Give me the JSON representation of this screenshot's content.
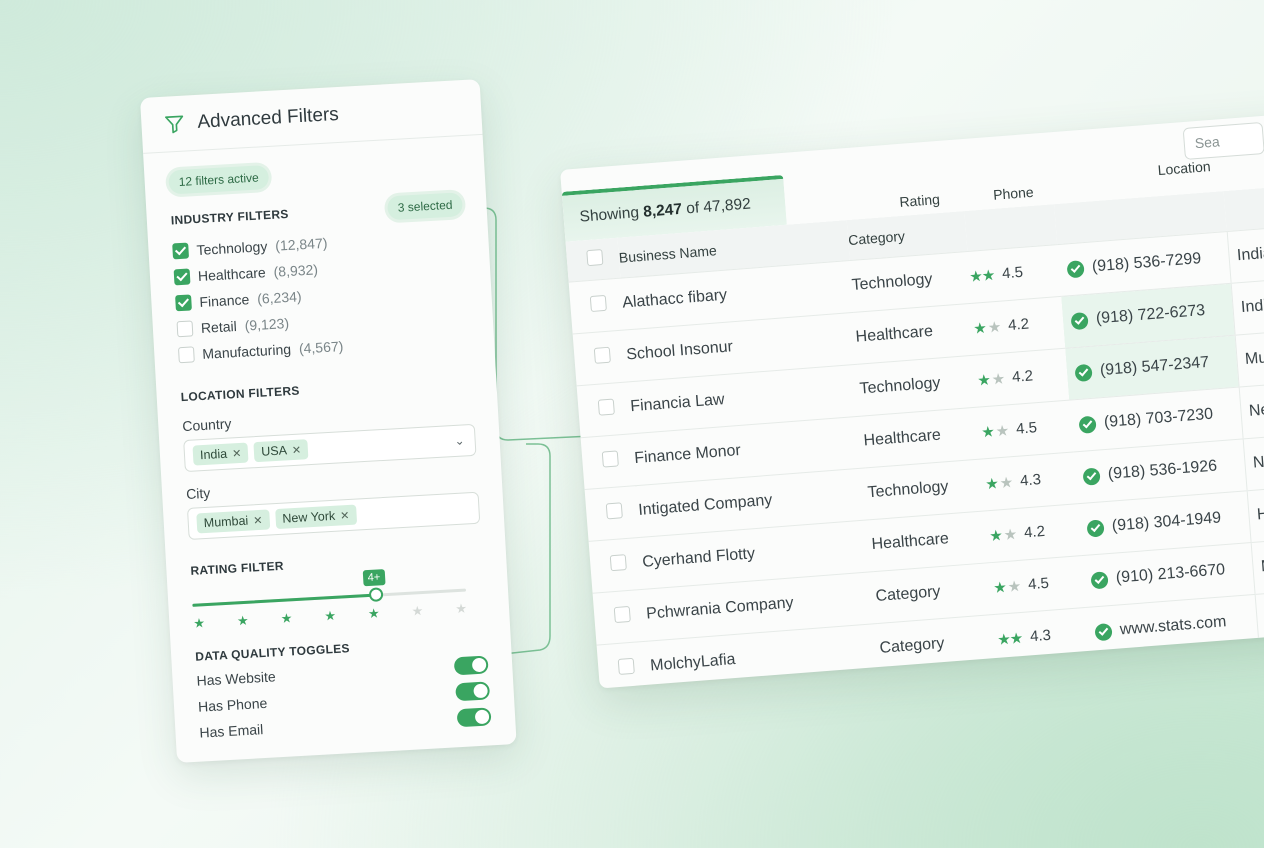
{
  "filters": {
    "title": "Advanced Filters",
    "active_badge": "12 filters active",
    "industry": {
      "title": "INDUSTRY FILTERS",
      "selected_badge": "3 selected",
      "items": [
        {
          "label": "Technology",
          "count": "(12,847)",
          "checked": true
        },
        {
          "label": "Healthcare",
          "count": "(8,932)",
          "checked": true
        },
        {
          "label": "Finance",
          "count": "(6,234)",
          "checked": true
        },
        {
          "label": "Retail",
          "count": "(9,123)",
          "checked": false
        },
        {
          "label": "Manufacturing",
          "count": "(4,567)",
          "checked": false
        }
      ]
    },
    "location": {
      "title": "LOCATION FILTERS",
      "country": {
        "label": "Country",
        "tags": [
          "India",
          "USA"
        ]
      },
      "city": {
        "label": "City",
        "tags": [
          "Mumbai",
          "New York"
        ]
      }
    },
    "rating": {
      "title": "RATING FILTER",
      "value_label": "4+",
      "min_stars": 4,
      "max_stars": 6,
      "fraction": 0.67
    },
    "toggles": {
      "title": "DATA QUALITY TOGGLES",
      "items": [
        {
          "label": "Has Website",
          "on": true
        },
        {
          "label": "Has Phone",
          "on": true
        },
        {
          "label": "Has Email",
          "on": true
        }
      ]
    }
  },
  "results": {
    "showing_prefix": "Showing",
    "showing_count": "8,247",
    "showing_of": "of 47,892",
    "search_placeholder": "Sea",
    "columns": {
      "name": "Business Name",
      "category": "Category",
      "rating": "Rating",
      "phone": "Phone",
      "location": "Location"
    },
    "rows": [
      {
        "name": "Alathacc fibary",
        "category": "Technology",
        "stars": "★★",
        "half": false,
        "rating": "4.5",
        "phone": "(918) 536-7299",
        "location": "India, Mumbai",
        "highlight": false
      },
      {
        "name": "School Insonur",
        "category": "Healthcare",
        "stars": "★",
        "half": true,
        "rating": "4.2",
        "phone": "(918) 722-6273",
        "location": "India, Mumbai",
        "highlight": true
      },
      {
        "name": "Financia Law",
        "category": "Technology",
        "stars": "★",
        "half": true,
        "rating": "4.2",
        "phone": "(918) 547-2347",
        "location": "Mumbai, India",
        "highlight": true
      },
      {
        "name": "Finance Monor",
        "category": "Healthcare",
        "stars": "★",
        "half": true,
        "rating": "4.5",
        "phone": "(918) 703-7230",
        "location": "New York",
        "highlight": false
      },
      {
        "name": "Intigated Company",
        "category": "Technology",
        "stars": "★",
        "half": true,
        "rating": "4.3",
        "phone": "(918) 536-1926",
        "location": "New York",
        "highlight": false
      },
      {
        "name": "Cyerhand Flotty",
        "category": "Healthcare",
        "stars": "★",
        "half": true,
        "rating": "4.2",
        "phone": "(918) 304-1949",
        "location": "Hariosl.",
        "highlight": false
      },
      {
        "name": "Pchwrania Company",
        "category": "Category",
        "stars": "★",
        "half": true,
        "rating": "4.5",
        "phone": "(910) 213-6670",
        "location": "Mumbai",
        "highlight": false
      },
      {
        "name": "MolchyLafia",
        "category": "Category",
        "stars": "★★",
        "half": false,
        "rating": "4.3",
        "phone": "www.stats.com",
        "location": "Mumbai",
        "highlight": false
      }
    ]
  },
  "colors": {
    "accent": "#3aa561",
    "accent_soft": "#d5efdf",
    "background": "#eef7f1"
  }
}
